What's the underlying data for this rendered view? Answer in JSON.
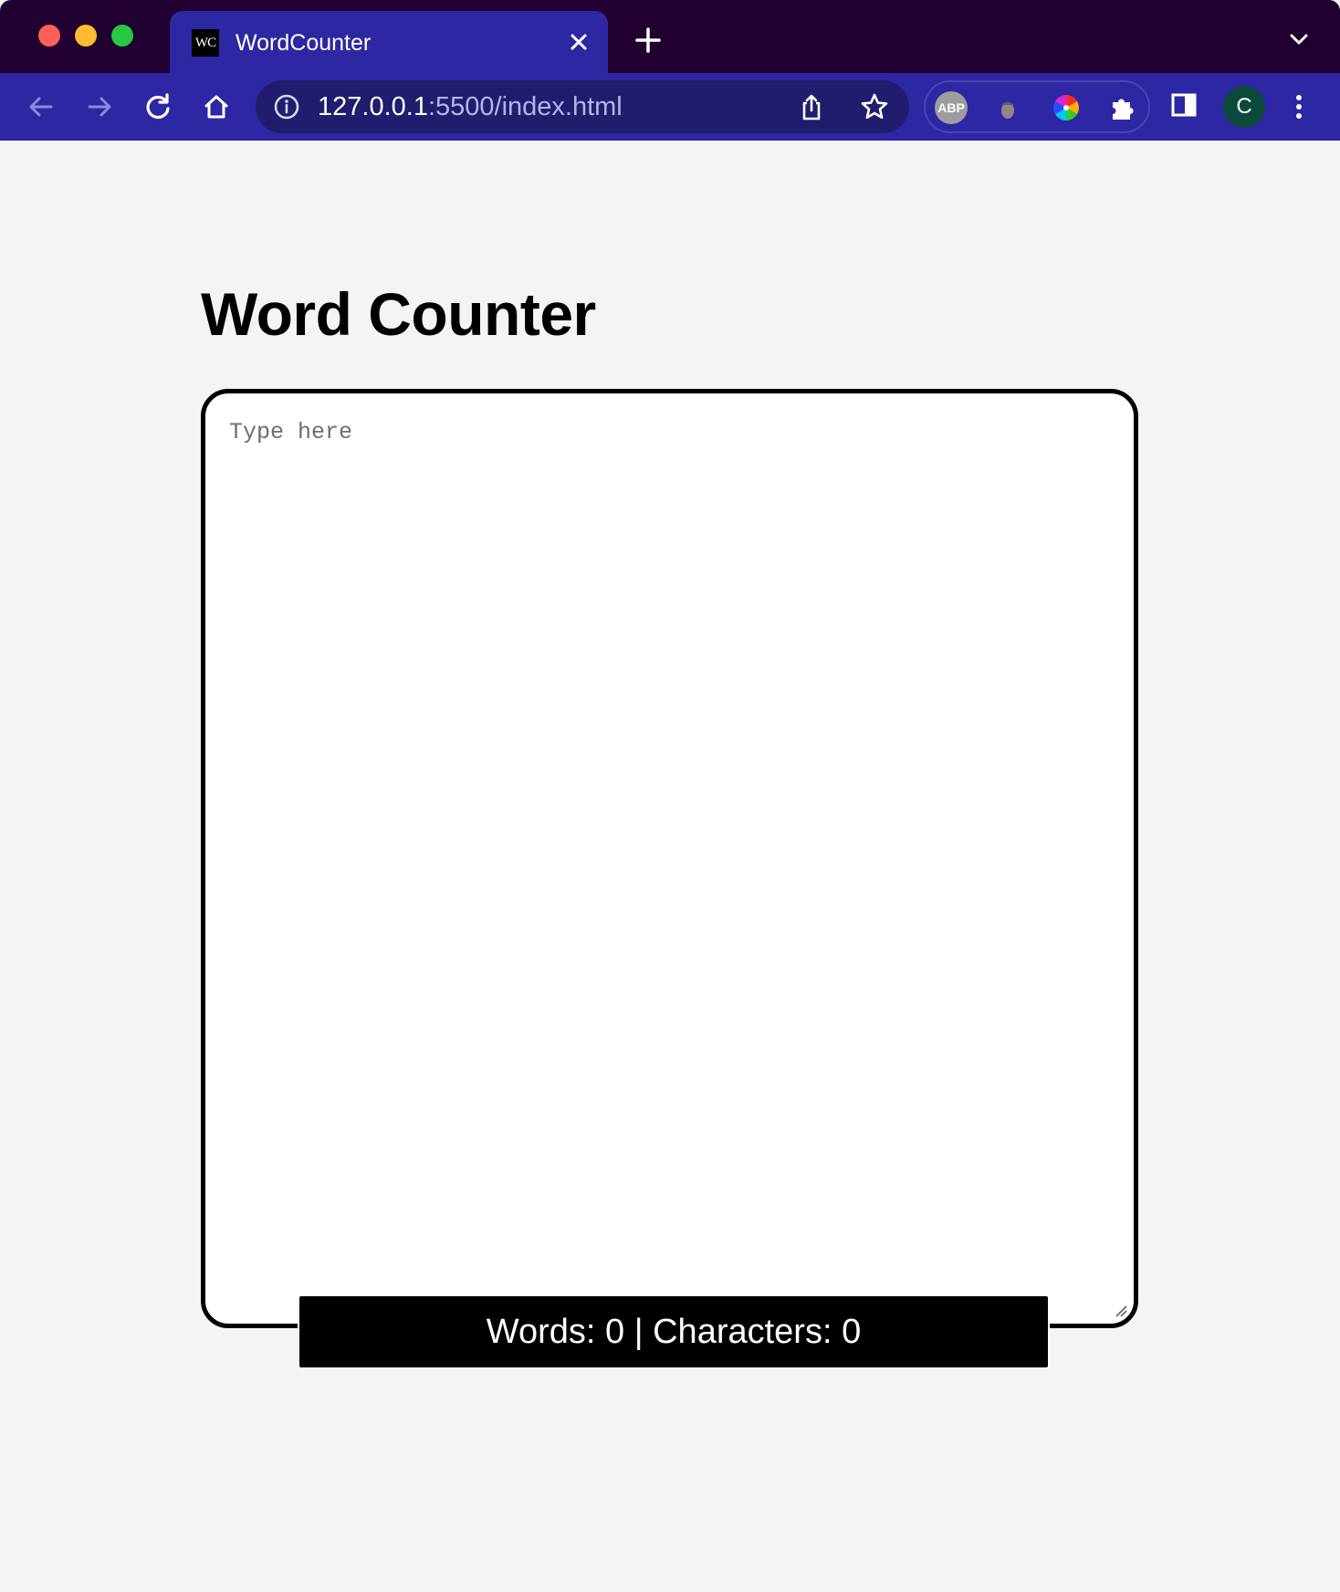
{
  "browser": {
    "tab": {
      "favicon_text": "WC",
      "title": "WordCounter"
    },
    "address_bar": {
      "host": "127.0.0.1",
      "rest": ":5500/index.html"
    },
    "extensions": {
      "abp_label": "ABP"
    },
    "profile_initial": "C",
    "theme": {
      "tabstrip_bg": "#1f0030",
      "toolbar_bg": "#2e27a3"
    }
  },
  "page": {
    "title": "Word Counter",
    "textarea": {
      "placeholder": "Type here",
      "value": ""
    },
    "counter": {
      "text": "Words: 0 | Characters: 0"
    }
  }
}
